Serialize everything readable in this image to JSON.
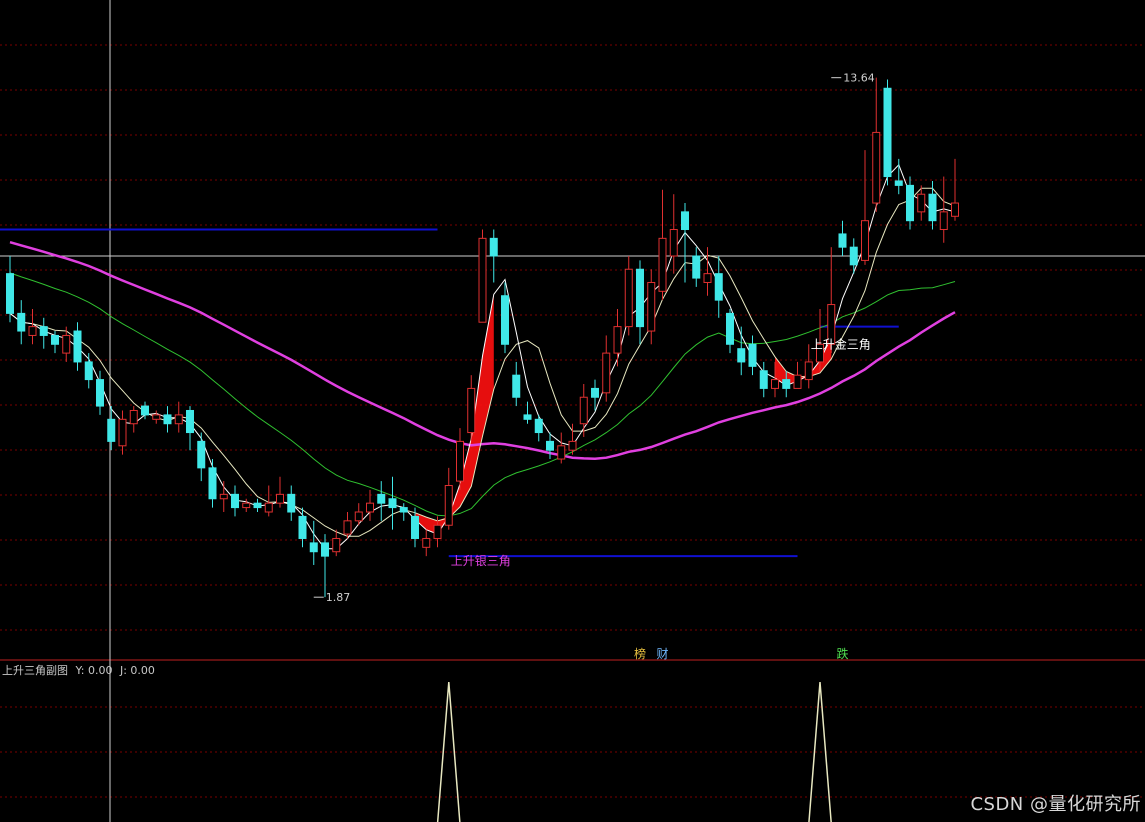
{
  "subchart": {
    "title": "上升三角副图",
    "y_label": "Y: 0.00",
    "j_label": "J: 0.00"
  },
  "watermark": "CSDN @量化研究所",
  "event_markers": [
    {
      "label": "榜",
      "color": "#e8c040",
      "x_index": 56
    },
    {
      "label": "财",
      "color": "#70b8ff",
      "x_index": 58
    },
    {
      "label": "跌",
      "color": "#50e050",
      "x_index": 74
    }
  ],
  "colors": {
    "background": "#000000",
    "grid": "#7a0000",
    "up": "#e03030",
    "down": "#40e8e8",
    "ma_short": "#ffffff",
    "ma_mid": "#e8e8c0",
    "ma_green": "#30c030",
    "ma_magenta": "#e040e0",
    "level_line": "#1010d0",
    "triangle_fill": "#ff1010",
    "signal_line": "#e8e8c0"
  },
  "chart_data": {
    "type": "candlestick",
    "ylim": [
      0.9,
      15.4
    ],
    "extremes": [
      {
        "label": "1.87",
        "index": 27,
        "value": 1.87
      },
      {
        "label": "13.64",
        "index": 73,
        "value": 13.64
      }
    ],
    "annotations": [
      {
        "label": "上升银三角",
        "color": "#e040e0",
        "index": 39,
        "value": 2.6
      },
      {
        "label": "上升金三角",
        "color": "#ffffff",
        "index": 71,
        "value": 7.5
      }
    ],
    "horizontal_levels": [
      {
        "value": 10.2,
        "from": 0,
        "to": 38
      },
      {
        "value": 2.8,
        "from": 39,
        "to": 70
      },
      {
        "value": 8.0,
        "from": 72,
        "to": 79
      }
    ],
    "price_line": 9.6,
    "candles": [
      [
        9.2,
        8.3,
        9.6,
        8.1
      ],
      [
        8.3,
        7.9,
        8.6,
        7.6
      ],
      [
        7.8,
        8.0,
        8.4,
        7.6
      ],
      [
        8.0,
        7.8,
        8.2,
        7.5
      ],
      [
        7.8,
        7.6,
        7.9,
        7.4
      ],
      [
        7.4,
        7.8,
        8.0,
        7.2
      ],
      [
        7.9,
        7.2,
        8.1,
        7.0
      ],
      [
        7.2,
        6.8,
        7.4,
        6.6
      ],
      [
        6.8,
        6.2,
        7.0,
        6.0
      ],
      [
        5.9,
        5.4,
        6.2,
        5.2
      ],
      [
        5.3,
        5.9,
        6.1,
        5.1
      ],
      [
        5.8,
        6.1,
        6.2,
        5.6
      ],
      [
        6.2,
        6.0,
        6.3,
        5.9
      ],
      [
        5.9,
        6.0,
        6.1,
        5.8
      ],
      [
        6.0,
        5.8,
        6.2,
        5.6
      ],
      [
        5.8,
        6.0,
        6.3,
        5.6
      ],
      [
        6.1,
        5.6,
        6.2,
        5.2
      ],
      [
        5.4,
        4.8,
        5.6,
        4.5
      ],
      [
        4.8,
        4.1,
        5.0,
        3.9
      ],
      [
        4.1,
        4.2,
        4.5,
        3.8
      ],
      [
        4.2,
        3.9,
        4.4,
        3.7
      ],
      [
        3.9,
        4.0,
        4.1,
        3.8
      ],
      [
        4.0,
        3.9,
        4.1,
        3.8
      ],
      [
        3.8,
        4.0,
        4.4,
        3.7
      ],
      [
        4.0,
        4.2,
        4.6,
        3.9
      ],
      [
        4.2,
        3.8,
        4.4,
        3.6
      ],
      [
        3.7,
        3.2,
        3.9,
        3.0
      ],
      [
        3.1,
        2.9,
        3.6,
        2.6
      ],
      [
        3.1,
        2.8,
        3.3,
        1.87
      ],
      [
        2.9,
        3.2,
        3.4,
        2.8
      ],
      [
        3.3,
        3.6,
        3.8,
        3.2
      ],
      [
        3.6,
        3.8,
        4.0,
        3.5
      ],
      [
        3.8,
        4.0,
        4.3,
        3.6
      ],
      [
        4.2,
        4.0,
        4.5,
        3.6
      ],
      [
        4.1,
        3.9,
        4.6,
        3.4
      ],
      [
        3.9,
        3.8,
        4.0,
        3.6
      ],
      [
        3.7,
        3.2,
        3.9,
        3.0
      ],
      [
        3.0,
        3.2,
        3.4,
        2.8
      ],
      [
        3.2,
        3.5,
        3.7,
        3.0
      ],
      [
        3.5,
        4.4,
        4.8,
        3.4
      ],
      [
        4.5,
        5.4,
        5.7,
        4.3
      ],
      [
        5.6,
        6.6,
        6.9,
        5.4
      ],
      [
        8.1,
        10.0,
        10.2,
        8.2
      ],
      [
        10.0,
        9.6,
        10.2,
        9.0
      ],
      [
        8.7,
        7.6,
        9.0,
        7.4
      ],
      [
        6.9,
        6.4,
        7.2,
        6.2
      ],
      [
        6.0,
        5.9,
        6.3,
        5.8
      ],
      [
        5.9,
        5.6,
        6.0,
        5.4
      ],
      [
        5.4,
        5.2,
        5.6,
        5.0
      ],
      [
        5.0,
        5.3,
        5.6,
        4.9
      ],
      [
        5.2,
        5.4,
        5.8,
        5.1
      ],
      [
        5.8,
        6.4,
        6.7,
        5.5
      ],
      [
        6.6,
        6.4,
        6.8,
        6.1
      ],
      [
        6.5,
        7.4,
        7.8,
        6.3
      ],
      [
        7.4,
        8.0,
        8.4,
        7.1
      ],
      [
        8.0,
        9.3,
        9.6,
        7.8
      ],
      [
        9.3,
        8.0,
        9.5,
        7.6
      ],
      [
        7.9,
        9.0,
        9.3,
        7.6
      ],
      [
        8.8,
        10.0,
        11.1,
        8.6
      ],
      [
        9.6,
        10.2,
        11.0,
        9.2
      ],
      [
        10.6,
        10.2,
        10.8,
        9.0
      ],
      [
        9.6,
        9.1,
        9.8,
        8.9
      ],
      [
        9.0,
        9.2,
        9.8,
        8.7
      ],
      [
        9.2,
        8.6,
        9.6,
        8.2
      ],
      [
        8.3,
        7.6,
        8.4,
        7.4
      ],
      [
        7.5,
        7.2,
        8.0,
        6.9
      ],
      [
        7.6,
        7.1,
        7.8,
        6.9
      ],
      [
        7.0,
        6.6,
        7.2,
        6.4
      ],
      [
        6.6,
        6.8,
        7.2,
        6.4
      ],
      [
        6.8,
        6.6,
        7.0,
        6.4
      ],
      [
        6.6,
        6.9,
        7.2,
        6.6
      ],
      [
        6.8,
        7.2,
        7.6,
        6.6
      ],
      [
        7.2,
        7.6,
        8.4,
        7.0
      ],
      [
        7.6,
        8.5,
        9.8,
        7.4
      ],
      [
        10.1,
        9.8,
        10.4,
        9.6
      ],
      [
        9.8,
        9.4,
        10.0,
        9.2
      ],
      [
        9.5,
        10.4,
        12.0,
        9.4
      ],
      [
        10.8,
        12.4,
        13.64,
        10.6
      ],
      [
        13.4,
        11.4,
        13.6,
        11.2
      ],
      [
        11.3,
        11.2,
        11.8,
        11.0
      ],
      [
        11.2,
        10.4,
        11.4,
        10.2
      ],
      [
        10.6,
        11.0,
        11.2,
        10.4
      ],
      [
        11.0,
        10.4,
        11.3,
        10.2
      ],
      [
        10.2,
        10.6,
        11.4,
        9.9
      ],
      [
        10.5,
        10.8,
        11.8,
        10.4
      ]
    ],
    "subchart_series": {
      "name": "上升三角副图",
      "ylim": [
        0,
        1
      ],
      "values_by_index": {
        "39": 1,
        "72": 1
      }
    }
  }
}
